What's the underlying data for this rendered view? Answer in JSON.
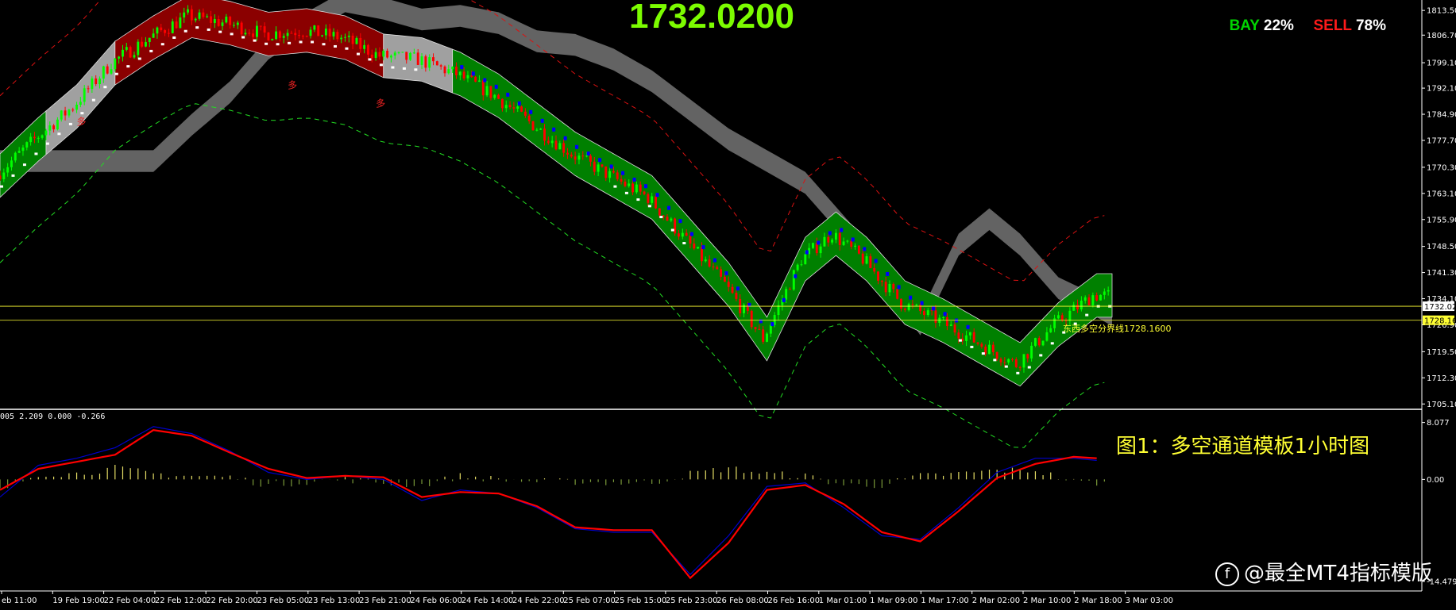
{
  "header": {
    "current_price": "1732.0200",
    "bay_label": "BAY",
    "bay_pct": "22%",
    "sell_label": "SELL",
    "sell_pct": "78%"
  },
  "annotations": {
    "boundary_label": "东西多空分界线1728.1600",
    "caption": "图1：多空通道模板1小时图",
    "watermark": "@最全MT4指标模版",
    "sub_readout": "005 2.209 0.000 -0.266",
    "trade_marks": [
      "多",
      "多",
      "多"
    ]
  },
  "colors": {
    "background": "#000000",
    "channel_up": "#008000",
    "channel_down": "#8b0000",
    "channel_neutral": "#a0a0a0",
    "band_gray": "#6e6e6e",
    "candle_up": "#00ff00",
    "candle_down": "#ff0000",
    "blue_line": "#0000ff",
    "macd_signal": "#ff0000",
    "macd_main": "#0000cc",
    "histogram_pos": "#e8e066",
    "histogram_neg": "#7a9a3a",
    "price_line": "#ffff33"
  },
  "chart_data": {
    "type": "line",
    "price_axis": {
      "ticks": [
        1813.5,
        1806.7,
        1799.1,
        1792.1,
        1784.9,
        1777.7,
        1770.3,
        1763.1,
        1755.9,
        1748.5,
        1741.3,
        1734.1,
        1726.9,
        1719.5,
        1712.3,
        1705.1
      ],
      "tick_labels": [
        "1813.50",
        "1806.70",
        "1799.10",
        "1792.10",
        "1784.90",
        "1777.70",
        "1770.30",
        "1763.10",
        "1755.90",
        "1748.50",
        "1741.30",
        "1734.10",
        "1726.90",
        "1719.50",
        "1712.30",
        "1705.10"
      ],
      "ylim": [
        1704.5,
        1815.5
      ],
      "current_price": 1732.02,
      "current_price_label": "1732.02",
      "boundary_price": 1728.16,
      "boundary_label": "1728.16"
    },
    "time_axis": {
      "labels": [
        "eb 11:00",
        "19 Feb 19:00",
        "22 Feb 04:00",
        "22 Feb 12:00",
        "22 Feb 20:00",
        "23 Feb 05:00",
        "23 Feb 13:00",
        "23 Feb 21:00",
        "24 Feb 06:00",
        "24 Feb 14:00",
        "24 Feb 22:00",
        "25 Feb 07:00",
        "25 Feb 15:00",
        "25 Feb 23:00",
        "26 Feb 08:00",
        "26 Feb 16:00",
        "1 Mar 01:00",
        "1 Mar 09:00",
        "1 Mar 17:00",
        "2 Mar 02:00",
        "2 Mar 10:00",
        "2 Mar 18:00",
        "3 Mar 03:00"
      ]
    },
    "price_series": {
      "x": [
        0,
        10,
        20,
        30,
        40,
        50,
        60,
        70,
        80,
        90,
        100,
        110,
        120,
        130,
        140,
        150,
        160,
        170,
        180,
        190,
        200,
        210,
        218,
        226,
        236,
        246,
        256,
        266,
        276,
        286
      ],
      "close": [
        1768,
        1778,
        1787,
        1799,
        1806,
        1812,
        1810,
        1807,
        1808,
        1806,
        1801,
        1800,
        1796,
        1790,
        1782,
        1774,
        1768,
        1762,
        1750,
        1738,
        1723,
        1745,
        1752,
        1745,
        1733,
        1728,
        1722,
        1716,
        1727,
        1735
      ]
    },
    "bars": 290,
    "indicator_axis": {
      "ticks": [
        8.077,
        0.0,
        -14.479
      ],
      "tick_labels": [
        "8.077",
        "0.00",
        "-14.479"
      ],
      "ylim": [
        -15.5,
        9.5
      ]
    },
    "indicator_series": [
      {
        "x": [
          0,
          10,
          20,
          30,
          40,
          50,
          60,
          70,
          80,
          90,
          100,
          110,
          120,
          130,
          140,
          150,
          160,
          170,
          180,
          190,
          200,
          210,
          220,
          230,
          240,
          250,
          260,
          270,
          280,
          286
        ],
        "values": [
          -2.5,
          2.0,
          3.0,
          4.5,
          7.5,
          6.5,
          4.0,
          1.0,
          0.0,
          0.5,
          0.0,
          -3.0,
          -1.5,
          -2.0,
          -4.0,
          -7.0,
          -7.5,
          -7.5,
          -13.5,
          -8.0,
          -1.0,
          -0.5,
          -4.0,
          -8.0,
          -8.5,
          -4.0,
          1.0,
          3.0,
          3.0,
          2.7
        ]
      },
      {
        "x": [
          0,
          10,
          20,
          30,
          40,
          50,
          60,
          70,
          80,
          90,
          100,
          110,
          120,
          130,
          140,
          150,
          160,
          170,
          180,
          190,
          200,
          210,
          220,
          230,
          240,
          250,
          260,
          270,
          280,
          286
        ],
        "values": [
          -1.5,
          1.5,
          2.5,
          3.5,
          7.0,
          6.2,
          3.8,
          1.5,
          0.2,
          0.5,
          0.3,
          -2.5,
          -1.8,
          -2.0,
          -3.8,
          -6.8,
          -7.2,
          -7.2,
          -14.0,
          -9.0,
          -1.5,
          -0.8,
          -3.5,
          -7.5,
          -8.8,
          -4.5,
          0.2,
          2.2,
          3.2,
          3.0
        ]
      }
    ]
  }
}
